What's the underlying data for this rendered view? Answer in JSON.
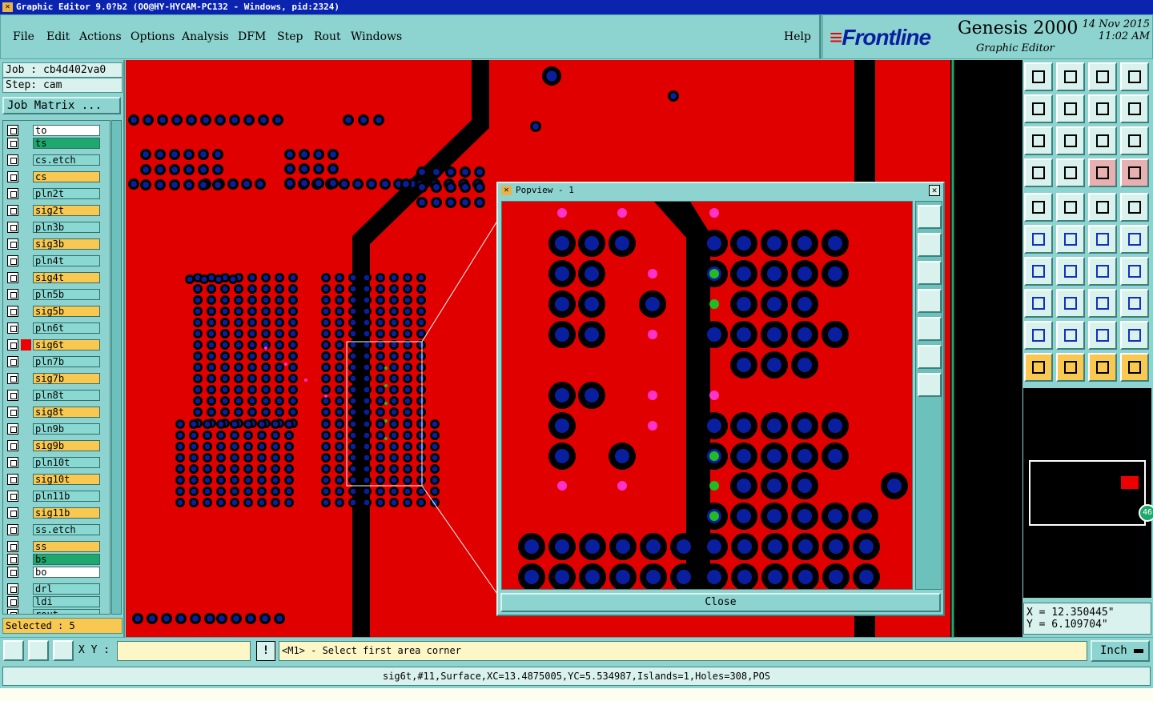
{
  "window_title": "Graphic Editor 9.0?b2 (OO@HY-HYCAM-PC132 - Windows, pid:2324)",
  "menu": [
    "File",
    "Edit",
    "Actions",
    "Options",
    "Analysis",
    "DFM",
    "Step",
    "Rout",
    "Windows",
    "Help"
  ],
  "brand": {
    "logo_text": "Frontline",
    "product": "Genesis 2000",
    "subtitle": "Graphic Editor",
    "date": "14 Nov 2015",
    "time": "11:02 AM"
  },
  "job": {
    "job_line": "Job : cb4d402va0",
    "step_line": "Step: cam",
    "job_matrix_button": "Job Matrix ..."
  },
  "layers": [
    {
      "name": "to",
      "color": "#ffffff"
    },
    {
      "name": "ts",
      "color": "#1ea86e"
    },
    {
      "name": "cs.etch",
      "color": "#8ad8d2"
    },
    {
      "name": "cs",
      "color": "#f8c850"
    },
    {
      "name": "pln2t",
      "color": "#8ad8d2"
    },
    {
      "name": "sig2t",
      "color": "#f8c850"
    },
    {
      "name": "pln3b",
      "color": "#8ad8d2"
    },
    {
      "name": "sig3b",
      "color": "#f8c850"
    },
    {
      "name": "pln4t",
      "color": "#8ad8d2"
    },
    {
      "name": "sig4t",
      "color": "#f8c850"
    },
    {
      "name": "pln5b",
      "color": "#8ad8d2"
    },
    {
      "name": "sig5b",
      "color": "#f8c850"
    },
    {
      "name": "pln6t",
      "color": "#8ad8d2"
    },
    {
      "name": "sig6t",
      "color": "#f8c850"
    },
    {
      "name": "pln7b",
      "color": "#8ad8d2"
    },
    {
      "name": "sig7b",
      "color": "#f8c850"
    },
    {
      "name": "pln8t",
      "color": "#8ad8d2"
    },
    {
      "name": "sig8t",
      "color": "#f8c850"
    },
    {
      "name": "pln9b",
      "color": "#8ad8d2"
    },
    {
      "name": "sig9b",
      "color": "#f8c850"
    },
    {
      "name": "pln10t",
      "color": "#8ad8d2"
    },
    {
      "name": "sig10t",
      "color": "#f8c850"
    },
    {
      "name": "pln11b",
      "color": "#8ad8d2"
    },
    {
      "name": "sig11b",
      "color": "#f8c850"
    },
    {
      "name": "ss.etch",
      "color": "#8ad8d2"
    },
    {
      "name": "ss",
      "color": "#f8c850"
    },
    {
      "name": "bs",
      "color": "#1ea86e"
    },
    {
      "name": "bo",
      "color": "#ffffff"
    },
    {
      "name": "drl",
      "color": "#8ad8d2"
    },
    {
      "name": "ldi",
      "color": "#8ad8d2"
    },
    {
      "name": "rout",
      "color": "#8ad8d2"
    }
  ],
  "active_layer": "sig6t",
  "selected_text": "Selected : 5",
  "popview": {
    "title": "Popview - 1",
    "close_label": "Close"
  },
  "overview_badge": "46",
  "coords": {
    "x": "X = 12.350445\"",
    "y": "Y = 6.109704\""
  },
  "xy_label": "X Y :",
  "xy_input_value": "",
  "prompt_text": "<M1> - Select first area corner",
  "unit": "Inch",
  "status_text": "sig6t,#11,Surface,XC=13.4875005,YC=5.534987,Islands=1,Holes=308,POS",
  "colors": {
    "board": "#e10000",
    "pad": "#0a1fa0",
    "pad_ring": "#000000",
    "magenta": "#ff33cc",
    "green": "#22bb22",
    "accent_ui": "#8dd3cf"
  }
}
